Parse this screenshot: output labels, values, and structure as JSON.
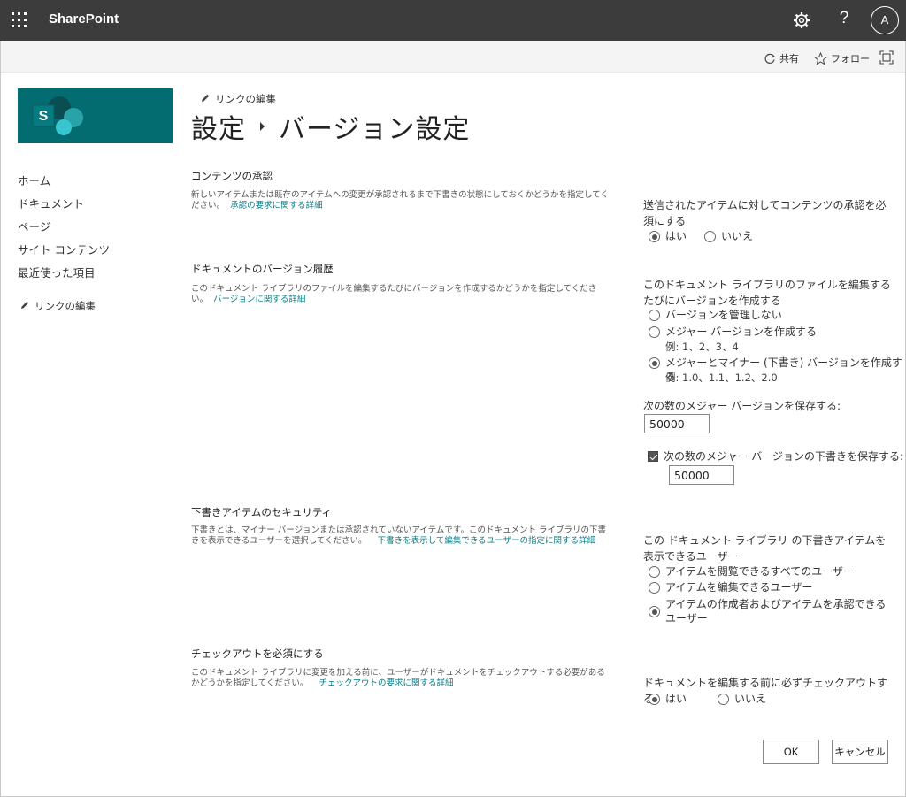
{
  "suitebar": {
    "brand": "SharePoint",
    "help": "?",
    "avatar_initial": "A"
  },
  "commandbar": {
    "share": "共有",
    "follow": "フォロー"
  },
  "nav": {
    "items": [
      "ホーム",
      "ドキュメント",
      "ページ",
      "サイト コンテンツ",
      "最近使った項目"
    ],
    "edit_links": "リンクの編集"
  },
  "header": {
    "edit_links": "リンクの編集",
    "breadcrumb_root": "設定",
    "breadcrumb_current": "バージョン設定"
  },
  "content_approval": {
    "heading": "コンテンツの承認",
    "desc": "新しいアイテムまたは既存のアイテムへの変更が承認されるまで下書きの状態にしておくかどうかを指定してください。",
    "link": "承認の要求に関する詳細",
    "label": "送信されたアイテムに対してコンテンツの承認を必須にする",
    "yes": "はい",
    "no": "いいえ",
    "selected": "yes"
  },
  "version_history": {
    "heading": "ドキュメントのバージョン履歴",
    "desc": "このドキュメント ライブラリのファイルを編集するたびにバージョンを作成するかどうかを指定してください。",
    "link": "バージョンに関する詳細",
    "label": "このドキュメント ライブラリのファイルを編集するたびにバージョンを作成する",
    "options": [
      {
        "label": "バージョンを管理しない",
        "example": ""
      },
      {
        "label": "メジャー バージョンを作成する",
        "example": "例: 1、2、3、4"
      },
      {
        "label": "メジャーとマイナー (下書き) バージョンを作成する",
        "example": "例: 1.0、1.1、1.2、2.0"
      }
    ],
    "selected_index": 2,
    "keep_major_label": "次の数のメジャー バージョンを保存する:",
    "keep_major_value": "50000",
    "keep_drafts_label": "次の数のメジャー バージョンの下書きを保存する:",
    "keep_drafts_checked": true,
    "keep_drafts_value": "50000"
  },
  "draft_security": {
    "heading": "下書きアイテムのセキュリティ",
    "desc": "下書きとは、マイナー バージョンまたは承認されていないアイテムです。このドキュメント ライブラリの下書きを表示できるユーザーを選択してください。",
    "link": "下書きを表示して編集できるユーザーの指定に関する詳細",
    "label": "この ドキュメント ライブラリ の下書きアイテムを表示できるユーザー",
    "options": [
      "アイテムを閲覧できるすべてのユーザー",
      "アイテムを編集できるユーザー",
      "アイテムの作成者およびアイテムを承認できるユーザー"
    ],
    "selected_index": 2
  },
  "checkout": {
    "heading": "チェックアウトを必須にする",
    "desc": "このドキュメント ライブラリに変更を加える前に、ユーザーがドキュメントをチェックアウトする必要があるかどうかを指定してください。",
    "link": "チェックアウトの要求に関する詳細",
    "label": "ドキュメントを編集する前に必ずチェックアウトする",
    "yes": "はい",
    "no": "いいえ",
    "selected": "yes"
  },
  "buttons": {
    "ok": "OK",
    "cancel": "キャンセル"
  }
}
